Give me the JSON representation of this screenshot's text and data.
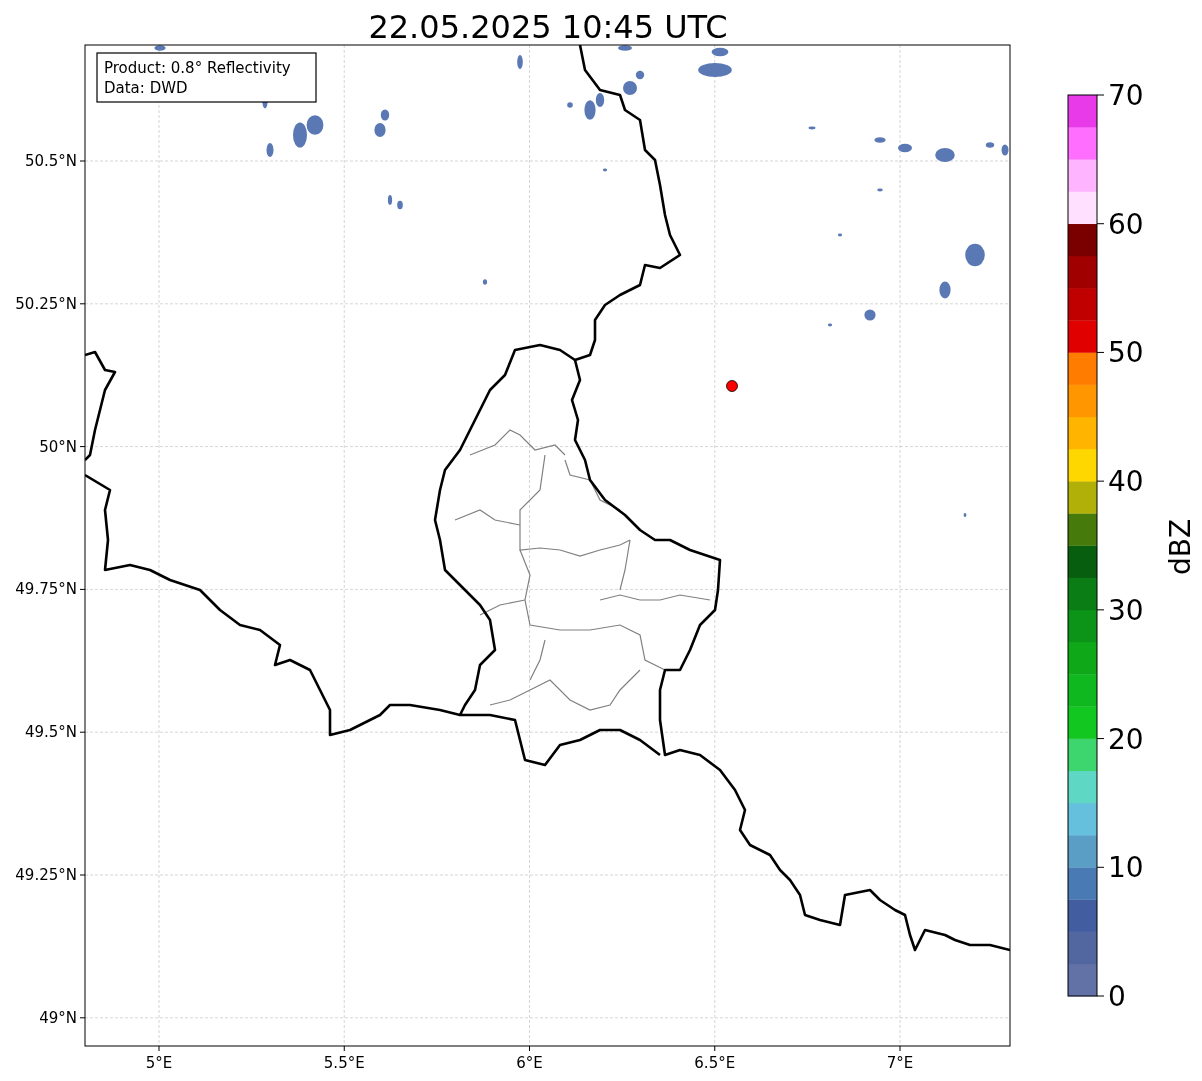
{
  "title": "22.05.2025 10:45 UTC",
  "info_box": [
    "Product: 0.8° Reflectivity",
    "Data: DWD"
  ],
  "x_ticks": [
    "5°E",
    "5.5°E",
    "6°E",
    "6.5°E",
    "7°E"
  ],
  "y_ticks": [
    "50.5°N",
    "50.25°N",
    "50°N",
    "49.75°N",
    "49.5°N",
    "49.25°N",
    "49°N"
  ],
  "colorbar": {
    "label": "dBZ",
    "ticks": [
      "70",
      "60",
      "50",
      "40",
      "30",
      "20",
      "10",
      "0"
    ],
    "segments": [
      {
        "color": "#6271a6"
      },
      {
        "color": "#5266a0"
      },
      {
        "color": "#425da0"
      },
      {
        "color": "#4a7ab4"
      },
      {
        "color": "#5a9ec6"
      },
      {
        "color": "#64c0dc"
      },
      {
        "color": "#5ed8c4"
      },
      {
        "color": "#3cd56e"
      },
      {
        "color": "#12c820"
      },
      {
        "color": "#10b820"
      },
      {
        "color": "#0ea818"
      },
      {
        "color": "#0c9418"
      },
      {
        "color": "#0a7e14"
      },
      {
        "color": "#065e0e"
      },
      {
        "color": "#467a0a"
      },
      {
        "color": "#b0b008"
      },
      {
        "color": "#ffd700"
      },
      {
        "color": "#ffb400"
      },
      {
        "color": "#ff9600"
      },
      {
        "color": "#ff7c00"
      },
      {
        "color": "#e00000"
      },
      {
        "color": "#c00000"
      },
      {
        "color": "#a00000"
      },
      {
        "color": "#7a0000"
      },
      {
        "color": "#ffe0ff"
      },
      {
        "color": "#ffb4ff"
      },
      {
        "color": "#ff6eff"
      },
      {
        "color": "#e83ae8"
      }
    ]
  }
}
